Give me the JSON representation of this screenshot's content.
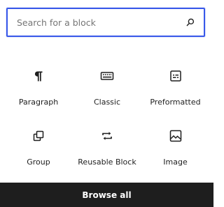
{
  "search": {
    "placeholder": "Search for a block",
    "value": "",
    "icon": "search-icon"
  },
  "blocks": [
    {
      "label": "Paragraph",
      "icon": "paragraph-icon"
    },
    {
      "label": "Classic",
      "icon": "keyboard-icon"
    },
    {
      "label": "Preformatted",
      "icon": "preformatted-icon"
    },
    {
      "label": "Group",
      "icon": "group-icon"
    },
    {
      "label": "Reusable Block",
      "icon": "reusable-icon"
    },
    {
      "label": "Image",
      "icon": "image-icon"
    }
  ],
  "footer": {
    "browse_all_label": "Browse all"
  },
  "colors": {
    "accent": "#3858e9",
    "footer_bg": "#1e1e1e",
    "text": "#1e1e1e",
    "placeholder": "#757575"
  }
}
